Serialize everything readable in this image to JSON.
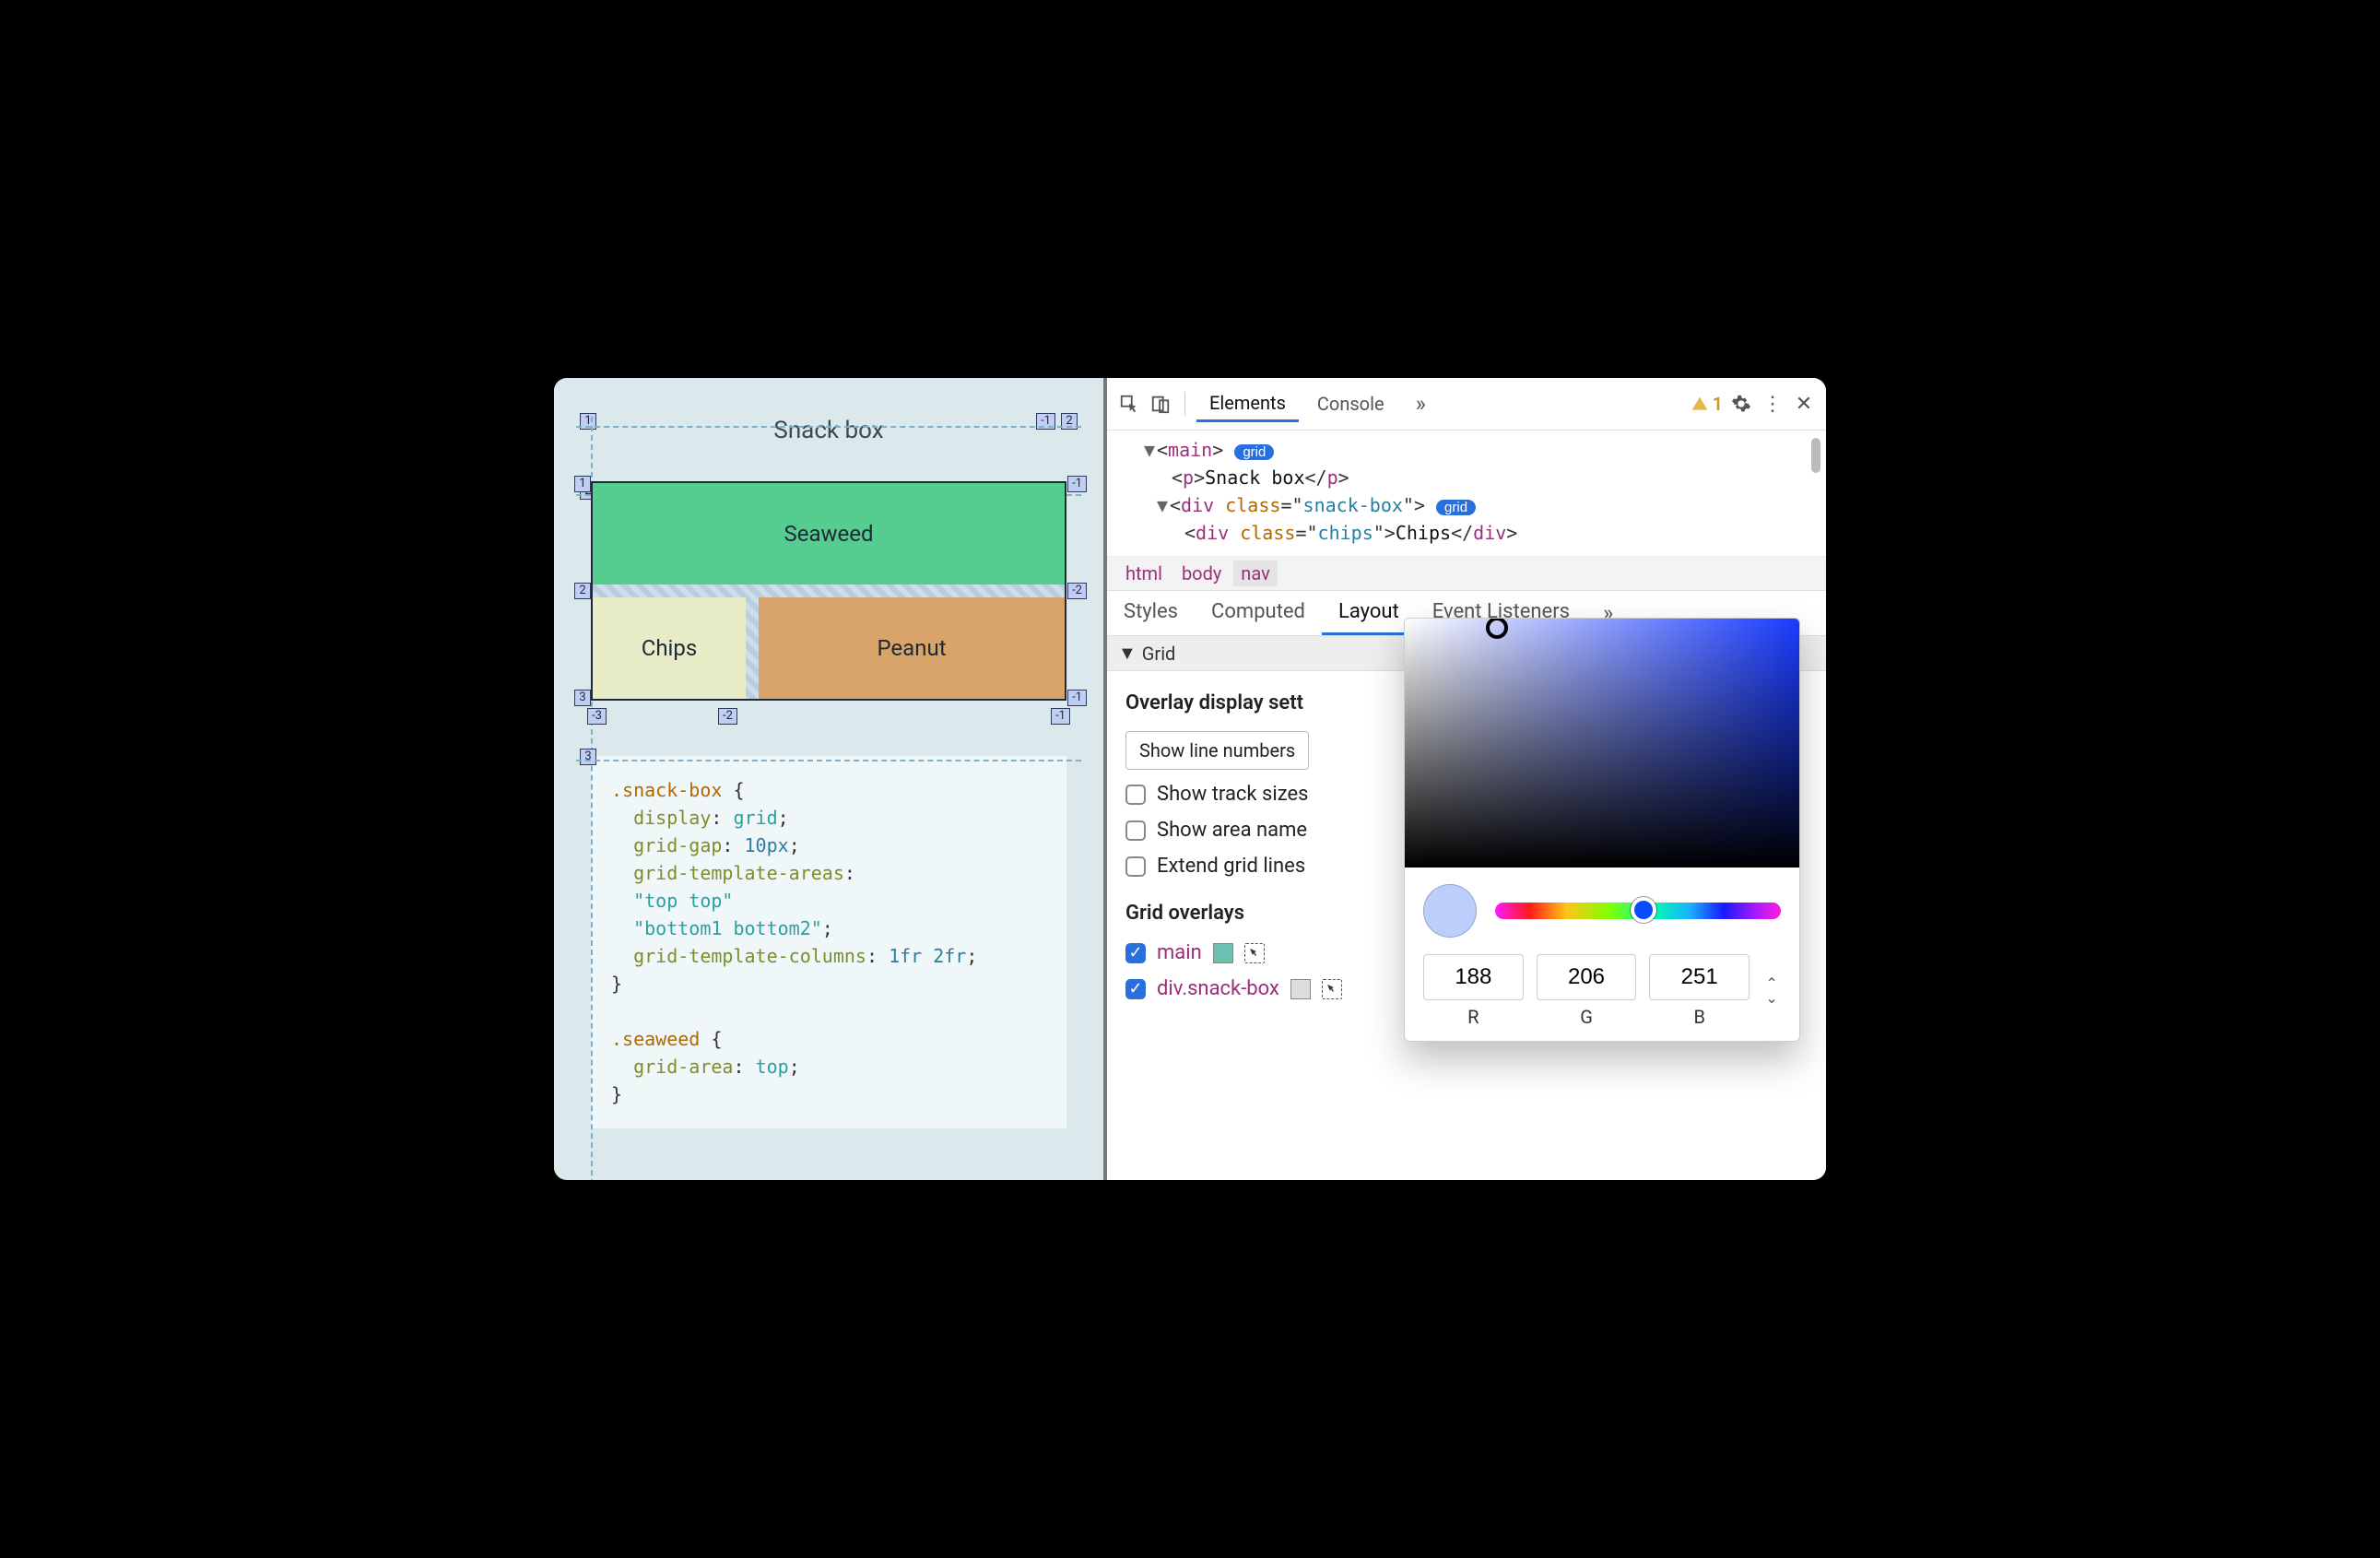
{
  "left": {
    "title": "Snack box",
    "grid_items": {
      "seaweed": "Seaweed",
      "chips": "Chips",
      "peanut": "Peanut"
    },
    "line_numbers": {
      "outer_top_left": "1",
      "outer_top_right": "-1",
      "row1_left": "1",
      "row1_right": "-1",
      "row2_label": "2",
      "col1": "1",
      "col2": "2",
      "col3": "3",
      "grid_row2_left": "2",
      "grid_row2_right": "-2",
      "grid_row3_left": "3",
      "grid_row3_right": "-1",
      "bot_neg3": "-3",
      "bot_neg2": "-2",
      "bot_neg1": "-1",
      "outer_row3": "3",
      "outer_col2": "2"
    },
    "code_lines": [
      {
        "text": ".snack-box {",
        "cls": "sel"
      },
      {
        "text": "  display: grid;",
        "prop": "display",
        "val": "grid"
      },
      {
        "text": "  grid-gap: 10px;",
        "prop": "grid-gap",
        "val": "10px"
      },
      {
        "text": "  grid-template-areas:",
        "prop": "grid-template-areas",
        "val": ""
      },
      {
        "text": "  \"top top\"",
        "cls": "valline"
      },
      {
        "text": "  \"bottom1 bottom2\";",
        "cls": "valline"
      },
      {
        "text": "  grid-template-columns: 1fr 2fr;",
        "prop": "grid-template-columns",
        "val": "1fr 2fr"
      },
      {
        "text": "}"
      },
      {
        "text": ""
      },
      {
        "text": ".seaweed {",
        "cls": "sel"
      },
      {
        "text": "  grid-area: top;",
        "prop": "grid-area",
        "val": "top"
      },
      {
        "text": "}"
      }
    ]
  },
  "toolbar": {
    "tabs": {
      "elements": "Elements",
      "console": "Console"
    },
    "more": "»",
    "warn_count": "1"
  },
  "dom": {
    "main_tag": "main",
    "grid_badge": "grid",
    "p_text": "Snack box",
    "div_class": "snack-box",
    "inner_div_class": "chips",
    "inner_div_text": "Chips"
  },
  "breadcrumbs": [
    "html",
    "body",
    "nav"
  ],
  "subtabs": {
    "styles": "Styles",
    "computed": "Computed",
    "layout": "Layout",
    "events": "Event Listeners",
    "more": "»"
  },
  "grid_section": "Grid",
  "overlay": {
    "heading": "Overlay display sett",
    "dropdown": "Show line numbers",
    "opts": {
      "track": "Show track sizes",
      "area": "Show area name",
      "extend": "Extend grid lines"
    }
  },
  "overlays_heading": "Grid overlays",
  "grid_overlays": [
    {
      "label": "main",
      "swatch": "#6cc0b0",
      "checked": true
    },
    {
      "label": "div.snack-box",
      "swatch": "#d0d0d0",
      "checked": true
    }
  ],
  "picker": {
    "r": "188",
    "g": "206",
    "b": "251",
    "r_label": "R",
    "g_label": "G",
    "b_label": "B",
    "swatch": "#bccefb"
  }
}
